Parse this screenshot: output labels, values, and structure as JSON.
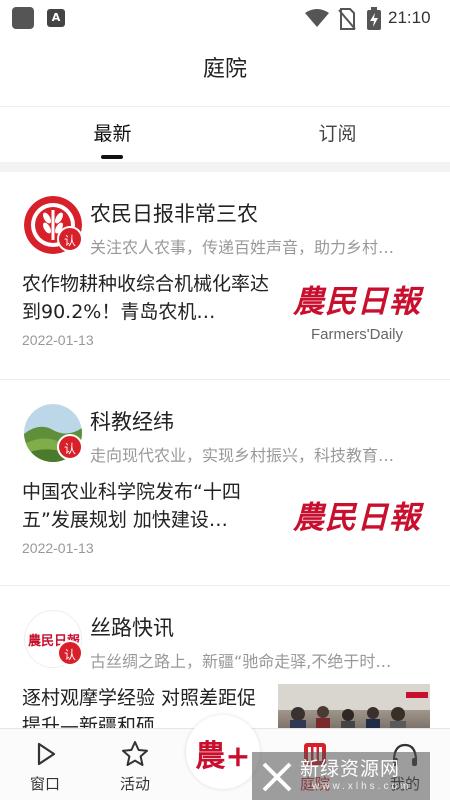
{
  "status_bar": {
    "app_badge": "A",
    "time": "21:10",
    "icons": [
      "app-icon",
      "wifi-icon",
      "no-sim-icon",
      "battery-charging-icon"
    ]
  },
  "header": {
    "title": "庭院"
  },
  "tabs": [
    {
      "label": "最新",
      "active": true
    },
    {
      "label": "订阅",
      "active": false
    }
  ],
  "feed": [
    {
      "source_name": "农民日报非常三农",
      "source_desc": "关注农人农事，传递百姓声音，助力乡村…",
      "verify_badge": "认证",
      "article_title": "农作物耕种收综合机械化率达到90.2%！青岛农机…",
      "date": "2022-01-13",
      "thumb_logo": "農民日報",
      "thumb_sub": "Farmers'Daily"
    },
    {
      "source_name": "科教经纬",
      "source_desc": "走向现代农业，实现乡村振兴，科技教育…",
      "verify_badge": "认证",
      "article_title": "中国农业科学院发布“十四五”发展规划 加快建设…",
      "date": "2022-01-13",
      "thumb_logo": "農民日報"
    },
    {
      "source_name": "丝路快讯",
      "source_desc": "古丝绸之路上，新疆“驰命走驿,不绝于时…",
      "verify_badge": "认证",
      "article_title": "逐村观摩学经验 对照差距促提升—新疆和硕…"
    }
  ],
  "bottom_nav": [
    {
      "label": "窗口",
      "icon": "play-icon"
    },
    {
      "label": "活动",
      "icon": "star-icon"
    },
    {
      "label": "",
      "icon": "center-logo-icon"
    },
    {
      "label": "庭院",
      "icon": "courtyard-icon",
      "active": true
    },
    {
      "label": "我的",
      "icon": "profile-icon"
    }
  ],
  "center_logo_text": "農+",
  "watermark": {
    "text": "新绿资源网",
    "sub": "www.xlhs.com"
  },
  "colors": {
    "brand_red": "#d8202a",
    "text_primary": "#222222",
    "text_secondary": "#999999"
  }
}
